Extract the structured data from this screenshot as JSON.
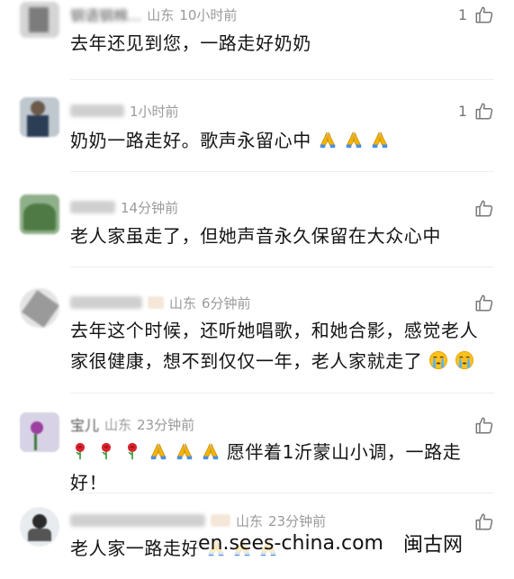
{
  "comments": [
    {
      "name": "钢语钢棉...",
      "location": "山东",
      "time": "10小时前",
      "text": "去年还见到您，一路走好奶奶",
      "likes": "1"
    },
    {
      "name": "",
      "location": "",
      "time": "1小时前",
      "text": "奶奶一路走好。歌声永留心中",
      "likes": "1"
    },
    {
      "name": "",
      "location": "",
      "time": "14分钟前",
      "text": "老人家虽走了，但她声音永久保留在大众心中",
      "likes": ""
    },
    {
      "name": "",
      "location": "山东",
      "time": "6分钟前",
      "text_line1": "去年这个时候，还听她唱歌，和她合影，感觉老人",
      "text_line2": "家很健康，想不到仅仅一年，老人家就走了",
      "likes": ""
    },
    {
      "name": "宝儿",
      "location": "山东",
      "time": "23分钟前",
      "text": "愿伴着1沂蒙山小调，一路走好！",
      "likes": ""
    },
    {
      "name": "",
      "location": "山东",
      "time": "23分钟前",
      "text": "老人家一路走好",
      "likes": ""
    }
  ],
  "watermark": {
    "site": "en.sees-china.com",
    "brand": "闽古网"
  },
  "icons": {
    "like": "thumbs-up-icon",
    "pray": "pray-emoji-icon",
    "cry": "crying-emoji-icon",
    "rose": "rose-emoji-icon"
  },
  "colors": {
    "text": "#141414",
    "meta": "#9a9a9a",
    "divider": "#eeeeee"
  }
}
